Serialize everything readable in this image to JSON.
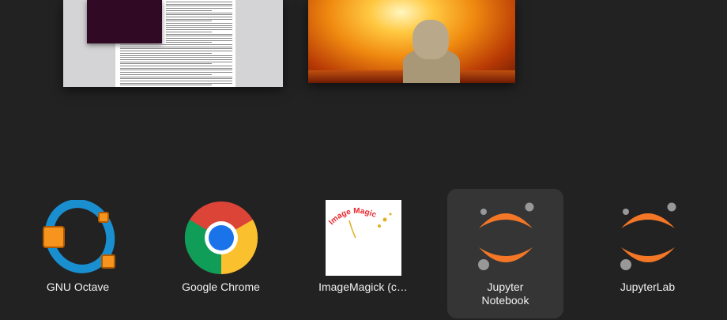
{
  "windows": [
    {
      "name": "document-window"
    },
    {
      "name": "image-viewer-window"
    }
  ],
  "apps": [
    {
      "label": "GNU Octave",
      "icon": "octave-icon"
    },
    {
      "label": "Google Chrome",
      "icon": "chrome-icon"
    },
    {
      "label": "ImageMagick (c…",
      "icon": "imagemagick-icon",
      "logo_text": "Image Magick"
    },
    {
      "label": "Jupyter Notebook",
      "icon": "jupyter-notebook-icon",
      "selected": true
    },
    {
      "label": "JupyterLab",
      "icon": "jupyterlab-icon"
    }
  ],
  "colors": {
    "background": "#222222",
    "selected_tile": "#353535",
    "jupyter_orange": "#f37726"
  }
}
